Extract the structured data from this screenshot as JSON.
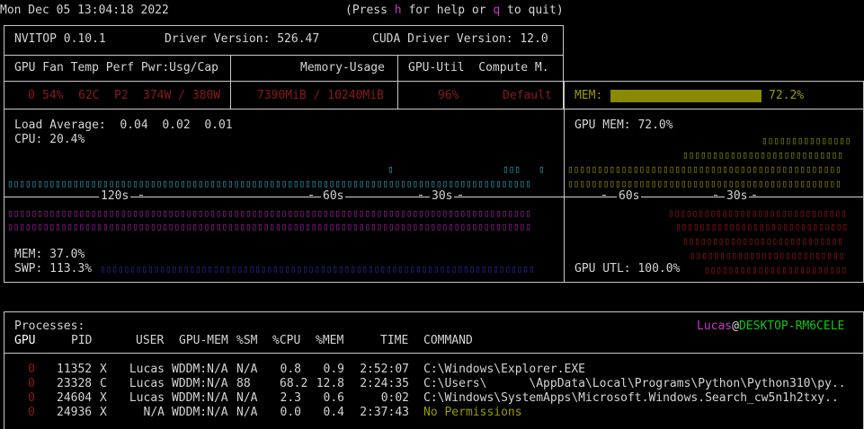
{
  "topbar": {
    "datetime": "Mon Dec 05 13:04:18 2022",
    "help_prefix": "(Press ",
    "help_key": "h",
    "help_mid": " for help or ",
    "quit_key": "q",
    "help_suffix": " to quit)"
  },
  "header": {
    "app": "NVITOP 0.10.1",
    "driver": "Driver Version: 526.47",
    "cuda": "CUDA Driver Version: 12.0",
    "col_gpu": "GPU Fan Temp Perf Pwr:Usg/Cap",
    "col_mem": "Memory-Usage",
    "col_util": "GPU-Util  Compute M."
  },
  "gpu": {
    "id": "0",
    "fan": "54%",
    "temp": "62C",
    "perf": "P2",
    "power": "374W / 380W",
    "memory": "7390MiB / 10240MiB",
    "util": "96%",
    "compute_mode": "Default",
    "mem_label": "MEM:",
    "mem_fraction": 0.722,
    "mem_pct": "72.2%"
  },
  "host": {
    "load_avg": "Load Average:  0.04  0.02  0.01",
    "cpu": "CPU: 20.4%",
    "mem": "MEM: 37.0%",
    "swp": "SWP: 113.3%",
    "axis_120": "120s",
    "axis_60": "60s",
    "axis_30": "30s"
  },
  "gpu_hist": {
    "gpu_mem": "GPU MEM: 72.0%",
    "gpu_utl": "GPU UTL: 100.0%",
    "axis_60": "60s",
    "axis_30": "30s"
  },
  "processes": {
    "title": "Processes:",
    "user": "Lucas",
    "at": "@",
    "host": "DESKTOP-RM6CELE",
    "headers": [
      "GPU",
      "PID",
      "USER",
      "GPU-MEM",
      "%SM",
      "%CPU",
      "%MEM",
      "TIME",
      "COMMAND"
    ],
    "rows": [
      {
        "gpu": "0",
        "pid": "11352",
        "type": "X",
        "user": "Lucas",
        "gpumem": "WDDM:N/A",
        "sm": "N/A",
        "cpu": "0.8",
        "mem": "0.9",
        "time": "2:52:07",
        "cmd": "C:\\Windows\\Explorer.EXE"
      },
      {
        "gpu": "0",
        "pid": "23328",
        "type": "C",
        "user": "Lucas",
        "gpumem": "WDDM:N/A",
        "sm": "88",
        "cpu": "68.2",
        "mem": "12.8",
        "time": "2:24:35",
        "cmd": "C:\\Users\\      \\AppData\\Local\\Programs\\Python\\Python310\\py.."
      },
      {
        "gpu": "0",
        "pid": "24604",
        "type": "X",
        "user": "Lucas",
        "gpumem": "WDDM:N/A",
        "sm": "N/A",
        "cpu": "2.3",
        "mem": "0.6",
        "time": "0:02",
        "cmd": "C:\\Windows\\SystemApps\\Microsoft.Windows.Search_cw5n1h2txy.."
      },
      {
        "gpu": "0",
        "pid": "24936",
        "type": "X",
        "user": "N/A",
        "gpumem": "WDDM:N/A",
        "sm": "N/A",
        "cpu": "0.0",
        "mem": "0.4",
        "time": "2:37:43",
        "cmd": "No Permissions"
      }
    ]
  }
}
